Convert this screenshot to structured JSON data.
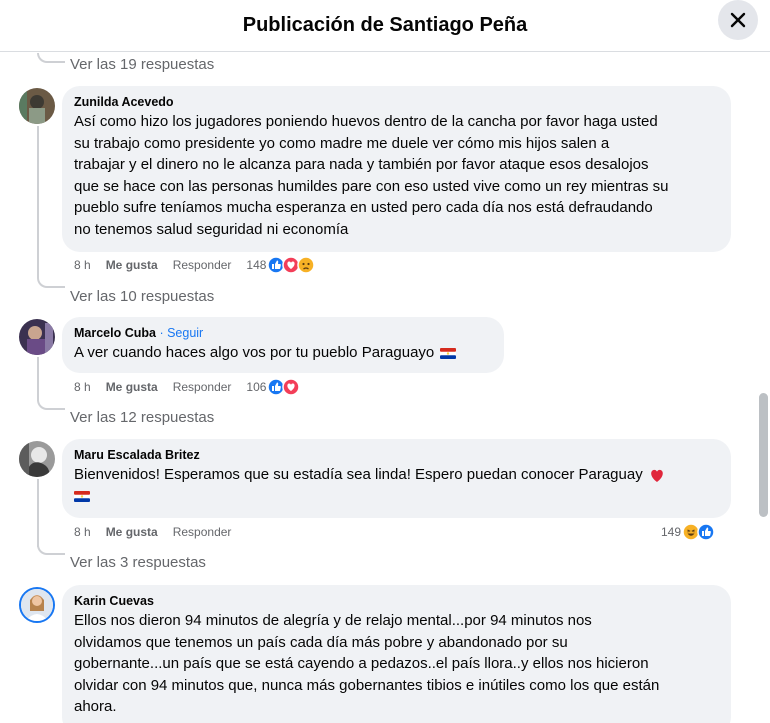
{
  "header": {
    "title": "Publicación de Santiago Peña"
  },
  "comments": [
    {
      "author": "Zunilda Acevedo",
      "text_lines": [
        "Así como hizo los jugadores poniendo huevos dentro de la cancha por favor haga usted",
        "su trabajo como presidente yo como madre me duele ver cómo mis hijos salen a",
        "trabajar y el dinero no le alcanza para nada y también por favor ataque esos desalojos",
        "que se hace con las personas humildes pare con eso usted vive como un rey mientras su",
        "pueblo sufre teníamos mucha esperanza en usted pero cada día nos está defraudando",
        "no tenemos salud seguridad ni economía"
      ],
      "time": "8 h",
      "like": "Me gusta",
      "reply": "Responder",
      "reaction_count": "148",
      "reactions": [
        "like-icon",
        "love-icon",
        "sad-icon"
      ],
      "view_replies": "Ver las 10 respuestas"
    },
    {
      "author": "Marcelo Cuba",
      "follow": " · Seguir",
      "text": "A ver cuando haces algo vos por tu pueblo Paraguayo",
      "time": "8 h",
      "like": "Me gusta",
      "reply": "Responder",
      "reaction_count": "106",
      "reactions": [
        "like-icon",
        "love-icon"
      ],
      "view_replies": "Ver las 12 respuestas"
    },
    {
      "author": "Maru Escalada Britez",
      "text": "Bienvenidos! Esperamos que su estadía sea linda! Espero puedan conocer Paraguay",
      "time": "8 h",
      "like": "Me gusta",
      "reply": "Responder",
      "reaction_count": "149",
      "reactions": [
        "haha-icon",
        "like-icon"
      ],
      "view_replies": "Ver las 3 respuestas"
    },
    {
      "author": "Karin Cuevas",
      "text_lines": [
        "Ellos nos dieron 94 minutos de alegría y de relajo mental...por 94 minutos nos",
        "olvidamos que tenemos un país cada día más pobre y abandonado por su",
        "gobernante...un país que se está cayendo a pedazos..el país llora..y ellos nos hicieron",
        "olvidar con 94 minutos que, nunca más gobernantes tibios e inútiles como los que están",
        "ahora."
      ]
    }
  ],
  "top_view_replies": "Ver las 19 respuestas",
  "colors": {
    "like": "#1877f2",
    "love": "#f33e58",
    "sad": "#f7b125",
    "link": "#1877f2",
    "bubble": "#f0f2f5"
  }
}
